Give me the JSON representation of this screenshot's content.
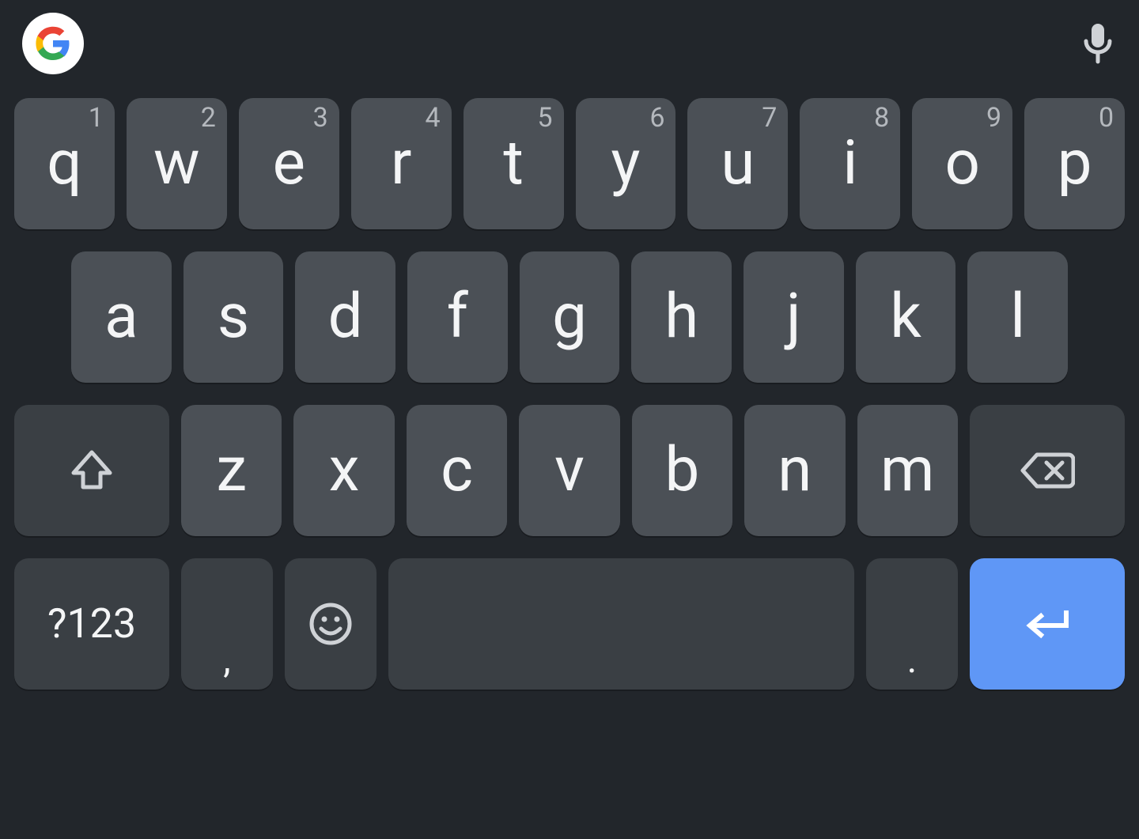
{
  "colors": {
    "background": "#22262b",
    "key": "#4b5056",
    "fn_key": "#3a3f44",
    "enter": "#5f97f6",
    "text": "#f4f5f6",
    "hint": "#b4b8bd"
  },
  "row1": [
    {
      "label": "q",
      "hint": "1"
    },
    {
      "label": "w",
      "hint": "2"
    },
    {
      "label": "e",
      "hint": "3"
    },
    {
      "label": "r",
      "hint": "4"
    },
    {
      "label": "t",
      "hint": "5"
    },
    {
      "label": "y",
      "hint": "6"
    },
    {
      "label": "u",
      "hint": "7"
    },
    {
      "label": "i",
      "hint": "8"
    },
    {
      "label": "o",
      "hint": "9"
    },
    {
      "label": "p",
      "hint": "0"
    }
  ],
  "row2": [
    {
      "label": "a"
    },
    {
      "label": "s"
    },
    {
      "label": "d"
    },
    {
      "label": "f"
    },
    {
      "label": "g"
    },
    {
      "label": "h"
    },
    {
      "label": "j"
    },
    {
      "label": "k"
    },
    {
      "label": "l"
    }
  ],
  "row3": [
    {
      "label": "z"
    },
    {
      "label": "x"
    },
    {
      "label": "c"
    },
    {
      "label": "v"
    },
    {
      "label": "b"
    },
    {
      "label": "n"
    },
    {
      "label": "m"
    }
  ],
  "row4": {
    "symbols_label": "?123",
    "comma_label": ",",
    "period_label": "."
  },
  "icons": {
    "google": "google-logo",
    "mic": "microphone-icon",
    "shift": "shift-icon",
    "backspace": "backspace-icon",
    "emoji": "emoji-icon",
    "enter": "enter-icon"
  }
}
